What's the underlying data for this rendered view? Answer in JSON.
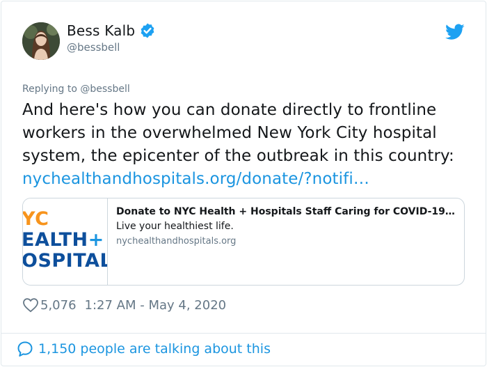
{
  "author": {
    "name": "Bess Kalb",
    "handle": "@bessbell",
    "verified": true
  },
  "tweet": {
    "replying_to": "Replying to @bessbell",
    "text": "And here's how you can donate directly to frontline workers in the overwhelmed New York City hospital system, the epicenter of the outbreak in this country: ",
    "link": "nychealthandhospitals.org/donate/?notifi…"
  },
  "link_card": {
    "thumbnail": {
      "line1": "YC",
      "line2": "EALTH",
      "line2_plus": "+",
      "line3": "OSPITAL"
    },
    "title": "Donate to NYC Health + Hospitals Staff Caring for COVID-19…",
    "description": "Live your healthiest life.",
    "domain": "nychealthandhospitals.org"
  },
  "meta": {
    "likes": "5,076",
    "timestamp": "1:27 AM - May 4, 2020"
  },
  "footer": {
    "talking": "1,150 people are talking about this"
  },
  "colors": {
    "accent": "#1b95e0",
    "muted": "#657786",
    "text": "#14171a",
    "border": "#e1e8ed",
    "thumb_orange": "#f7941d",
    "thumb_blue": "#0d4f9c"
  },
  "icons": {
    "verified": "verified-badge-icon",
    "bird": "twitter-bird-icon",
    "heart": "heart-icon",
    "bubble": "comment-bubble-icon"
  }
}
